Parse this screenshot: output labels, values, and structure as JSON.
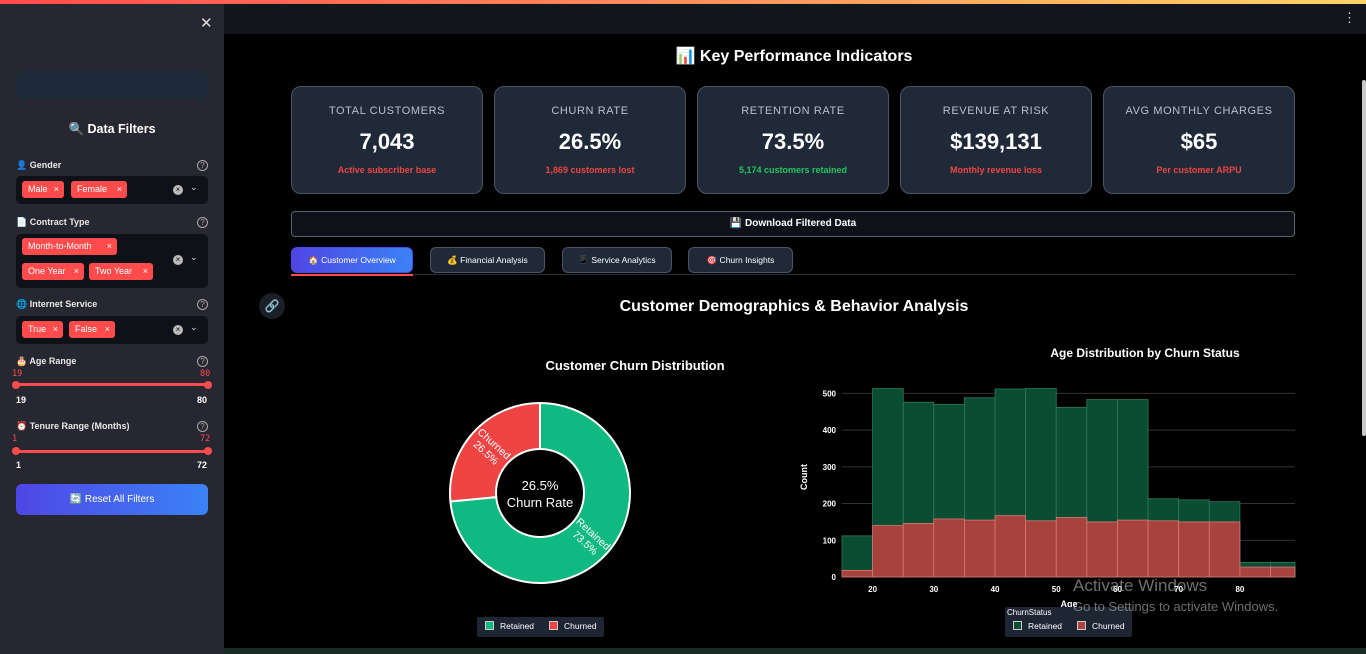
{
  "sidebar": {
    "close_icon": "close-icon",
    "title": "🔍 Data Filters",
    "gender": {
      "label": "👤 Gender",
      "chips": [
        "Male",
        "Female"
      ]
    },
    "contract": {
      "label": "📄 Contract Type",
      "chips": [
        "Month-to-Month",
        "One Year",
        "Two Year"
      ]
    },
    "internet": {
      "label": "🌐 Internet Service",
      "chips": [
        "True",
        "False"
      ]
    },
    "age": {
      "label": "🎂 Age Range",
      "cur_min": "19",
      "cur_max": "80",
      "min": "19",
      "max": "80"
    },
    "tenure": {
      "label": "⏰ Tenure Range (Months)",
      "cur_min": "1",
      "cur_max": "72",
      "min": "1",
      "max": "72"
    },
    "reset_label": "🔄 Reset All Filters",
    "chip_remove": "×",
    "help_glyph": "?",
    "clear_glyph": "×",
    "chevron_glyph": "⌄"
  },
  "header": {
    "title": "📊 Key Performance Indicators",
    "menu_glyph": "⋮"
  },
  "kpis": [
    {
      "label": "TOTAL CUSTOMERS",
      "value": "7,043",
      "sub": "Active subscriber base",
      "sub_color": "red"
    },
    {
      "label": "CHURN RATE",
      "value": "26.5%",
      "sub": "1,869 customers lost",
      "sub_color": "red"
    },
    {
      "label": "RETENTION RATE",
      "value": "73.5%",
      "sub": "5,174 customers retained",
      "sub_color": "green"
    },
    {
      "label": "REVENUE AT RISK",
      "value": "$139,131",
      "sub": "Monthly revenue loss",
      "sub_color": "red"
    },
    {
      "label": "AVG MONTHLY CHARGES",
      "value": "$65",
      "sub": "Per customer ARPU",
      "sub_color": "red"
    }
  ],
  "download_label": "💾 Download Filtered Data",
  "tabs": [
    {
      "label": "🏠 Customer Overview",
      "active": true
    },
    {
      "label": "💰 Financial Analysis",
      "active": false
    },
    {
      "label": "📱 Service Analytics",
      "active": false
    },
    {
      "label": "🎯 Churn Insights",
      "active": false
    }
  ],
  "link_glyph": "🔗",
  "section_title": "Customer Demographics & Behavior Analysis",
  "colors": {
    "retained": "#10b981",
    "churned": "#ef4444",
    "accent": "#ff4b4b",
    "hist_retained": "#0b4d33",
    "hist_churned": "#b0413e"
  },
  "chart_data": [
    {
      "type": "pie",
      "title": "Customer Churn Distribution",
      "center_text": [
        "26.5%",
        "Churn Rate"
      ],
      "slices": [
        {
          "name": "Retained",
          "value": 73.5,
          "label": [
            "Retained",
            "73.5%"
          ]
        },
        {
          "name": "Churned",
          "value": 26.5,
          "label": [
            "Churned",
            "26.5%"
          ]
        }
      ],
      "legend": [
        "Retained",
        "Churned"
      ],
      "legend_position": "bottom"
    },
    {
      "type": "bar",
      "title": "Age Distribution by Churn Status",
      "xlabel": "Age",
      "ylabel": "Count",
      "xlim": [
        15,
        89
      ],
      "ylim": [
        0,
        550
      ],
      "xticks": [
        20,
        30,
        40,
        50,
        60,
        70,
        80
      ],
      "yticks": [
        0,
        100,
        200,
        300,
        400,
        500
      ],
      "bin_width": 5,
      "bin_starts": [
        15,
        20,
        25,
        30,
        35,
        40,
        45,
        50,
        55,
        60,
        65,
        70,
        75,
        80,
        85
      ],
      "bin_widths": [
        5,
        5,
        5,
        5,
        5,
        5,
        5,
        5,
        5,
        5,
        5,
        5,
        5,
        5,
        4
      ],
      "series": [
        {
          "name": "Retained",
          "values": [
            112,
            513,
            476,
            470,
            488,
            512,
            513,
            462,
            483,
            483,
            213,
            210,
            205,
            40,
            40
          ]
        },
        {
          "name": "Churned",
          "values": [
            18,
            140,
            146,
            158,
            155,
            167,
            153,
            162,
            150,
            155,
            153,
            150,
            150,
            27,
            27
          ]
        }
      ],
      "legend_title": "ChurnStatus",
      "legend": [
        "Retained",
        "Churned"
      ],
      "legend_position": "bottom",
      "grid": true
    }
  ],
  "watermark": {
    "line1": "Activate Windows",
    "line2": "Go to Settings to activate Windows."
  }
}
